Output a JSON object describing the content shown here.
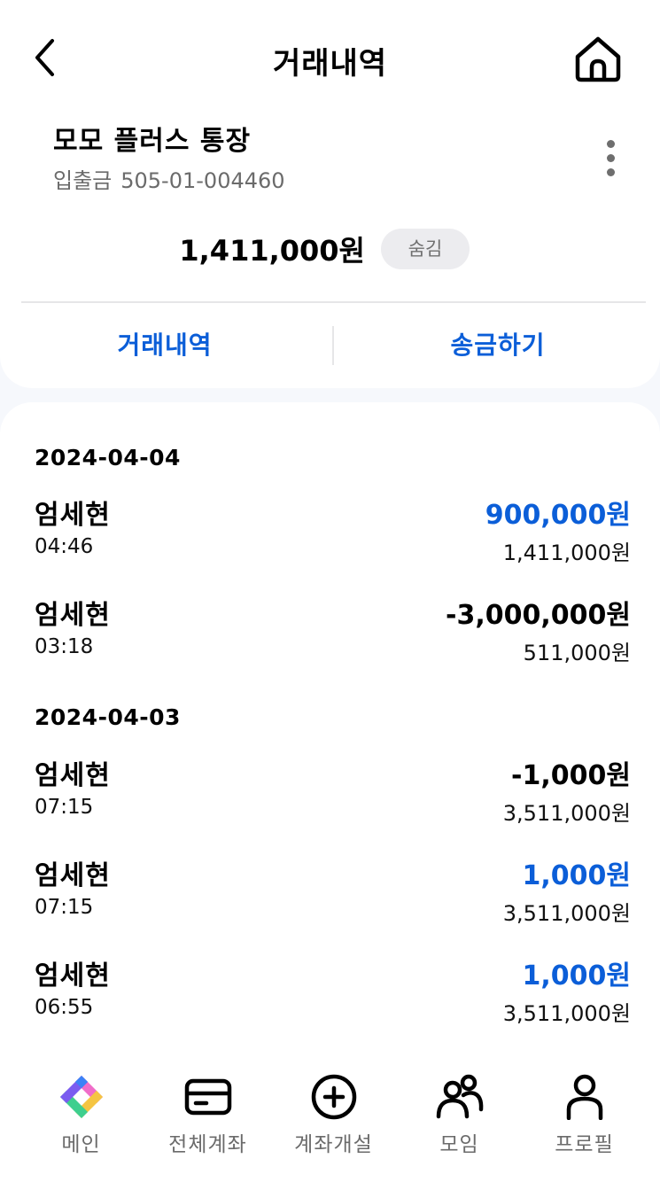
{
  "header": {
    "title": "거래내역"
  },
  "account": {
    "name": "모모 플러스 통장",
    "type": "입출금",
    "number": "505-01-004460",
    "balance": "1,411,000원",
    "hide_label": "숨김"
  },
  "tabs": [
    {
      "label": "거래내역"
    },
    {
      "label": "송금하기"
    }
  ],
  "groups": [
    {
      "date": "2024-04-04",
      "transactions": [
        {
          "name": "엄세현",
          "time": "04:46",
          "amount": "900,000원",
          "direction": "in",
          "balance": "1,411,000원"
        },
        {
          "name": "엄세현",
          "time": "03:18",
          "amount": "-3,000,000원",
          "direction": "out",
          "balance": "511,000원"
        }
      ]
    },
    {
      "date": "2024-04-03",
      "transactions": [
        {
          "name": "엄세현",
          "time": "07:15",
          "amount": "-1,000원",
          "direction": "out",
          "balance": "3,511,000원"
        },
        {
          "name": "엄세현",
          "time": "07:15",
          "amount": "1,000원",
          "direction": "in",
          "balance": "3,511,000원"
        },
        {
          "name": "엄세현",
          "time": "06:55",
          "amount": "1,000원",
          "direction": "in",
          "balance": "3,511,000원"
        }
      ]
    }
  ],
  "nav": [
    {
      "label": "메인",
      "icon": "app-logo-icon"
    },
    {
      "label": "전체계좌",
      "icon": "card-icon"
    },
    {
      "label": "계좌개설",
      "icon": "plus-circle-icon"
    },
    {
      "label": "모임",
      "icon": "group-icon"
    },
    {
      "label": "프로필",
      "icon": "person-icon"
    }
  ],
  "colors": {
    "accent": "#0b5ed8",
    "muted": "#6b6b6b",
    "background": "#f6f8fc"
  }
}
